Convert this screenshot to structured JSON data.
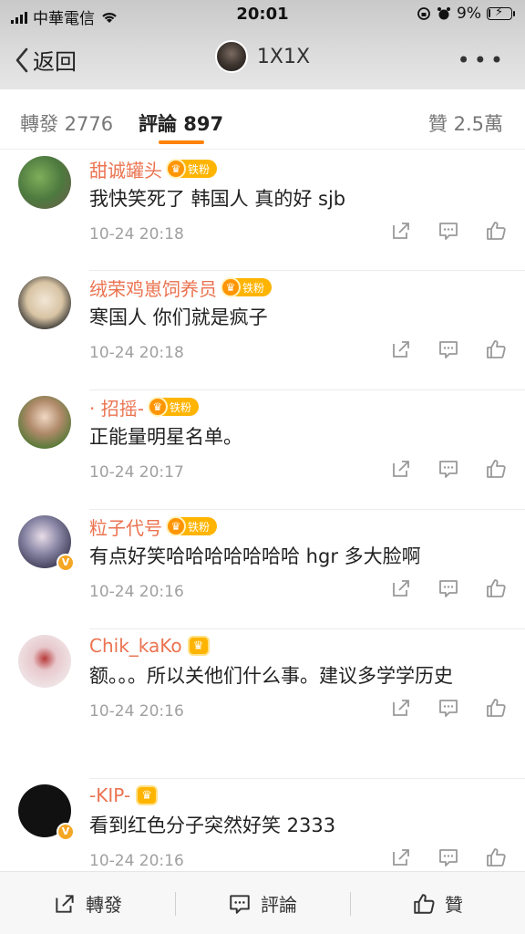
{
  "status_bar": {
    "carrier": "中華電信",
    "time": "20:01",
    "battery": "9%",
    "battery_level": 0.09
  },
  "nav": {
    "back_label": "返回",
    "title": "1X1X",
    "more": "•••"
  },
  "tabs": [
    {
      "label": "轉發 2776"
    },
    {
      "label": "評論 897"
    },
    {
      "label": "贊 2.5萬"
    }
  ],
  "comments": [
    {
      "user": "甜诚罐头",
      "badge": "铁粉",
      "text": "我快笑死了 韩国人 真的好 sjb",
      "time": "10-24 20:18",
      "verified": false,
      "avatar_color": "#4d7a3f"
    },
    {
      "user": "绒荣鸡崽饲养员",
      "badge": "铁粉",
      "text": "寒国人 你们就是疯子",
      "time": "10-24 20:18",
      "verified": false,
      "avatar_color": "#c9b89a"
    },
    {
      "user": "· 招摇-",
      "badge": "铁粉",
      "text": "正能量明星名单。",
      "time": "10-24 20:17",
      "verified": false,
      "avatar_color": "#8a9b6e"
    },
    {
      "user": "粒子代号",
      "badge": "铁粉",
      "text": "有点好笑哈哈哈哈哈哈哈 hgr 多大脸啊",
      "time": "10-24 20:16",
      "verified": true,
      "avatar_color": "#6d6a86"
    },
    {
      "user": "Chik_kaKo",
      "badge": "",
      "text": "额。。。所以关他们什么事。建议多学学历史",
      "time": "10-24 20:16",
      "verified": false,
      "avatar_color": "#e7d4d6"
    },
    {
      "user": "-KIP-",
      "badge": "",
      "text": "看到红色分子突然好笑 2333",
      "time": "10-24 20:16",
      "verified": true,
      "avatar_color": "#111111"
    }
  ],
  "bottom_bar": {
    "repost": "轉發",
    "comment": "評論",
    "like": "贊"
  },
  "colors": {
    "accent": "#ff8200",
    "username": "#eb7350",
    "fan_badge": "#ffb400"
  }
}
